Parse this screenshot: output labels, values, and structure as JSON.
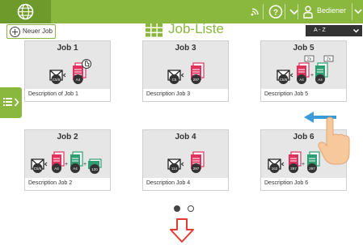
{
  "topbar": {
    "logo_icon": "globe-logo-icon",
    "icons": [
      "wifi-icon",
      "help-icon",
      "chevron-down-icon",
      "user-icon"
    ],
    "user_label": "Bediener",
    "accent": "#8ab83f",
    "accent_dark": "#6d9a2a"
  },
  "header": {
    "new_job_label": "Neuer Job",
    "title": "Job-Liste",
    "sort_value": "A - Z"
  },
  "jobs": [
    {
      "name": "Job 1",
      "description": "Description of Job 1",
      "badges": [
        "C5/6",
        "A4"
      ]
    },
    {
      "name": "Job 3",
      "description": "Description Job 3",
      "badges": [
        "C5",
        "297"
      ]
    },
    {
      "name": "Job 5",
      "description": "Description Job 5",
      "badges": [
        "C5/6",
        "A4",
        "A4"
      ],
      "multipliers": [
        "2x",
        "2x"
      ]
    },
    {
      "name": "Job 2",
      "description": "Description Job 2",
      "badges": [
        "C5/6",
        "A4",
        "A4",
        "120"
      ]
    },
    {
      "name": "Job 4",
      "description": "Description Job 4",
      "badges": [
        "114",
        "297"
      ]
    },
    {
      "name": "Job 6",
      "description": "Description Job 6",
      "badges": [
        "162",
        "297",
        "297"
      ]
    }
  ],
  "pager": {
    "pages": 2,
    "current": 1
  }
}
